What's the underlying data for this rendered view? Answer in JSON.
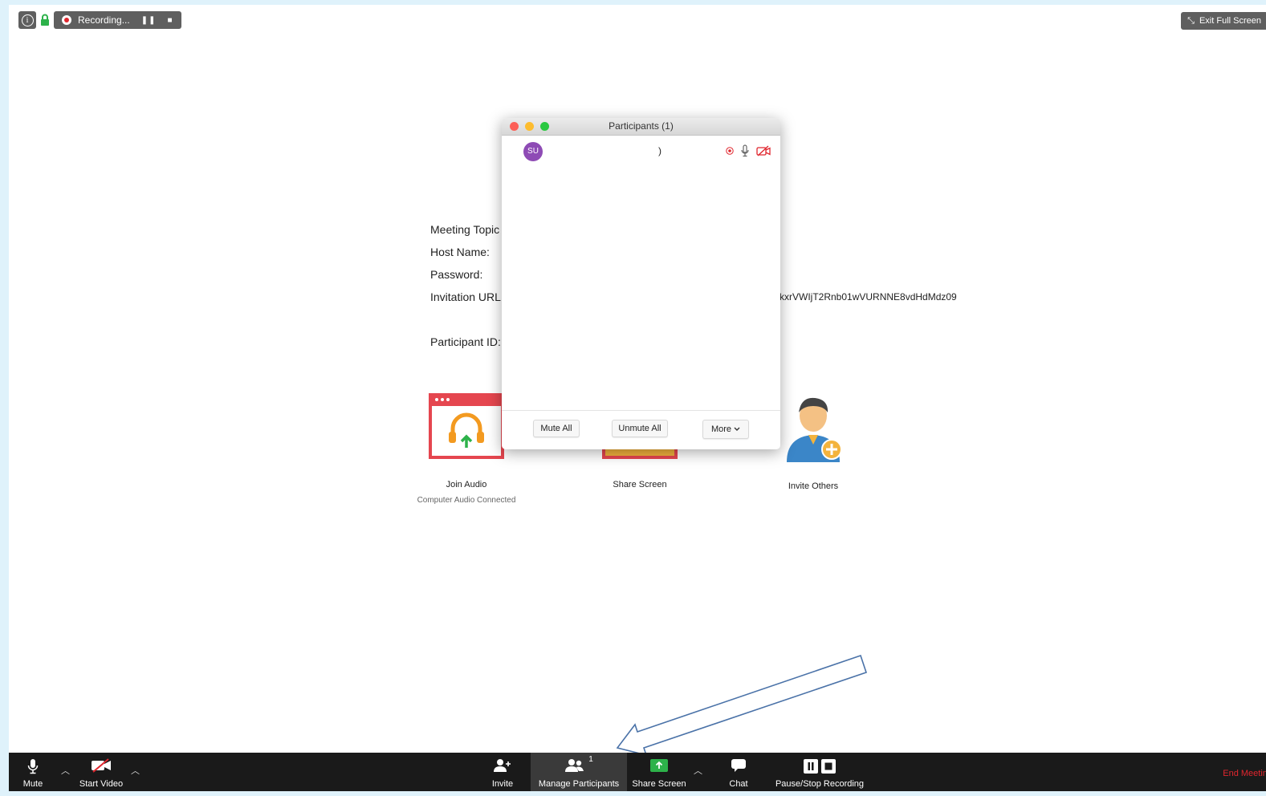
{
  "topbar": {
    "info_icon": "i",
    "recording_label": "Recording...",
    "pause_glyph": "❚❚",
    "stop_glyph": "■",
    "exit_fullscreen": "Exit Full Screen"
  },
  "meeting_info": {
    "topic_label": "Meeting Topic",
    "host_label": "Host Name:",
    "password_label": "Password:",
    "url_label": "Invitation URL",
    "url_tail": "kxrVWIjT2Rnb01wVURNNE8vdHdMdz09",
    "participant_id_label": "Participant ID:"
  },
  "actions": {
    "join_audio": "Join Audio",
    "join_audio_sub": "Computer Audio Connected",
    "share_screen": "Share Screen",
    "invite_others": "Invite Others"
  },
  "participants_dialog": {
    "title": "Participants (1)",
    "participant": {
      "initials": "SU",
      "name": ")"
    },
    "buttons": {
      "mute_all": "Mute All",
      "unmute_all": "Unmute All",
      "more": "More"
    }
  },
  "toolbar": {
    "mute": "Mute",
    "start_video": "Start Video",
    "invite": "Invite",
    "manage_participants": "Manage Participants",
    "participant_count": "1",
    "share_screen": "Share Screen",
    "chat": "Chat",
    "pause_stop_recording": "Pause/Stop Recording",
    "end_meeting": "End Meeting"
  },
  "colors": {
    "recording_red": "#e0262e",
    "avatar_purple": "#8e4bb5",
    "share_green": "#2db24a",
    "arrow_blue": "#4a72a8"
  }
}
